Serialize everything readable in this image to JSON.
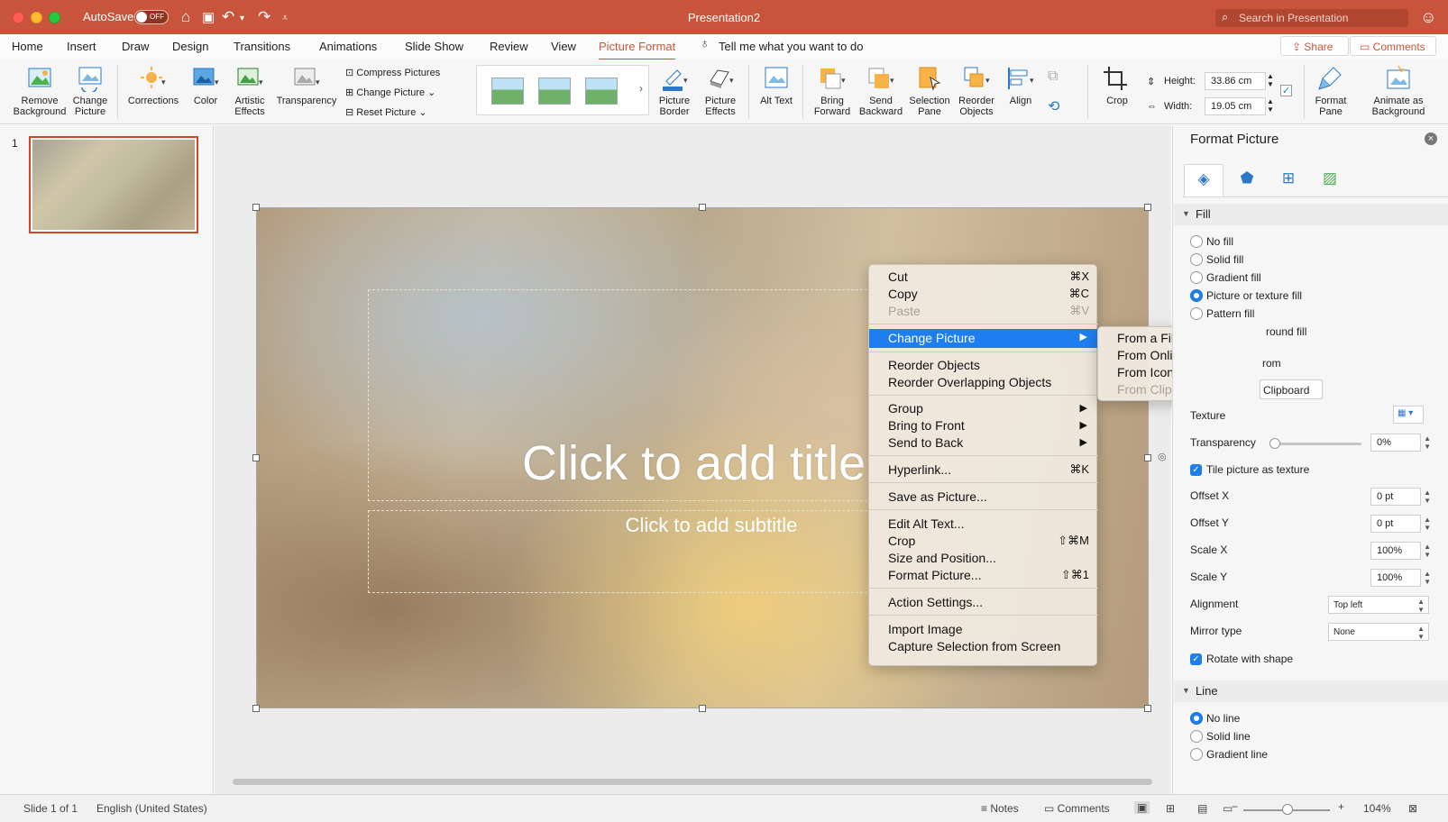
{
  "titlebar": {
    "autosave_label": "AutoSave",
    "autosave_state": "OFF",
    "document_title": "Presentation2",
    "search_placeholder": "Search in Presentation"
  },
  "menu": {
    "tabs": [
      "Home",
      "Insert",
      "Draw",
      "Design",
      "Transitions",
      "Animations",
      "Slide Show",
      "Review",
      "View",
      "Picture Format"
    ],
    "active_tab": "Picture Format",
    "tell_me": "Tell me what you want to do",
    "share_label": "Share",
    "comments_label": "Comments"
  },
  "ribbon": {
    "remove_background": "Remove Background",
    "change_picture": "Change Picture",
    "corrections": "Corrections",
    "color": "Color",
    "artistic_effects": "Artistic Effects",
    "transparency": "Transparency",
    "compress_pictures": "Compress Pictures",
    "change_picture_small": "Change Picture",
    "reset_picture": "Reset Picture",
    "picture_border": "Picture Border",
    "picture_effects": "Picture Effects",
    "alt_text": "Alt Text",
    "bring_forward": "Bring Forward",
    "send_backward": "Send Backward",
    "selection_pane": "Selection Pane",
    "reorder_objects": "Reorder Objects",
    "align": "Align",
    "crop": "Crop",
    "height_label": "Height:",
    "height_value": "33.86 cm",
    "width_label": "Width:",
    "width_value": "19.05 cm",
    "format_pane": "Format Pane",
    "animate_as_background": "Animate as Background"
  },
  "thumbnails": {
    "slide_number": "1"
  },
  "slide": {
    "title_placeholder": "Click to add title",
    "subtitle_placeholder": "Click to add subtitle"
  },
  "context_menu": {
    "cut": "Cut",
    "cut_shortcut": "⌘X",
    "copy": "Copy",
    "copy_shortcut": "⌘C",
    "paste": "Paste",
    "paste_shortcut": "⌘V",
    "change_picture": "Change Picture",
    "reorder_objects": "Reorder Objects",
    "reorder_overlapping": "Reorder Overlapping Objects",
    "group": "Group",
    "bring_to_front": "Bring to Front",
    "send_to_back": "Send to Back",
    "hyperlink": "Hyperlink...",
    "hyperlink_shortcut": "⌘K",
    "save_as_picture": "Save as Picture...",
    "edit_alt_text": "Edit Alt Text...",
    "crop": "Crop",
    "crop_shortcut": "⇧⌘M",
    "size_and_position": "Size and Position...",
    "format_picture": "Format Picture...",
    "format_picture_shortcut": "⇧⌘1",
    "action_settings": "Action Settings...",
    "import_image": "Import Image",
    "capture_selection": "Capture Selection from Screen"
  },
  "submenu": {
    "from_file": "From a File...",
    "from_online": "From Online Sources...",
    "from_icons": "From Icons...",
    "from_clipboard": "From Clipboard..."
  },
  "format_pane": {
    "title": "Format Picture",
    "fill_section": "Fill",
    "no_fill": "No fill",
    "solid_fill": "Solid fill",
    "gradient_fill": "Gradient fill",
    "picture_texture_fill": "Picture or texture fill",
    "pattern_fill": "Pattern fill",
    "partial_background_fill": "round fill",
    "partial_from": "rom",
    "clipboard": "Clipboard",
    "texture": "Texture",
    "transparency": "Transparency",
    "transparency_value": "0%",
    "tile_picture": "Tile picture as texture",
    "offset_x": "Offset X",
    "offset_x_value": "0 pt",
    "offset_y": "Offset Y",
    "offset_y_value": "0 pt",
    "scale_x": "Scale X",
    "scale_x_value": "100%",
    "scale_y": "Scale Y",
    "scale_y_value": "100%",
    "alignment": "Alignment",
    "alignment_value": "Top left",
    "mirror_type": "Mirror type",
    "mirror_type_value": "None",
    "rotate_with_shape": "Rotate with shape",
    "line_section": "Line",
    "no_line": "No line",
    "solid_line": "Solid line",
    "gradient_line": "Gradient line",
    "selected_fill": "Picture or texture fill",
    "selected_line": "No line"
  },
  "statusbar": {
    "slide_info": "Slide 1 of 1",
    "language": "English (United States)",
    "notes": "Notes",
    "comments": "Comments",
    "zoom": "104%",
    "zoom_fraction": 0.5
  },
  "colors": {
    "accent": "#c8553b",
    "highlight": "#1e7ef0"
  }
}
